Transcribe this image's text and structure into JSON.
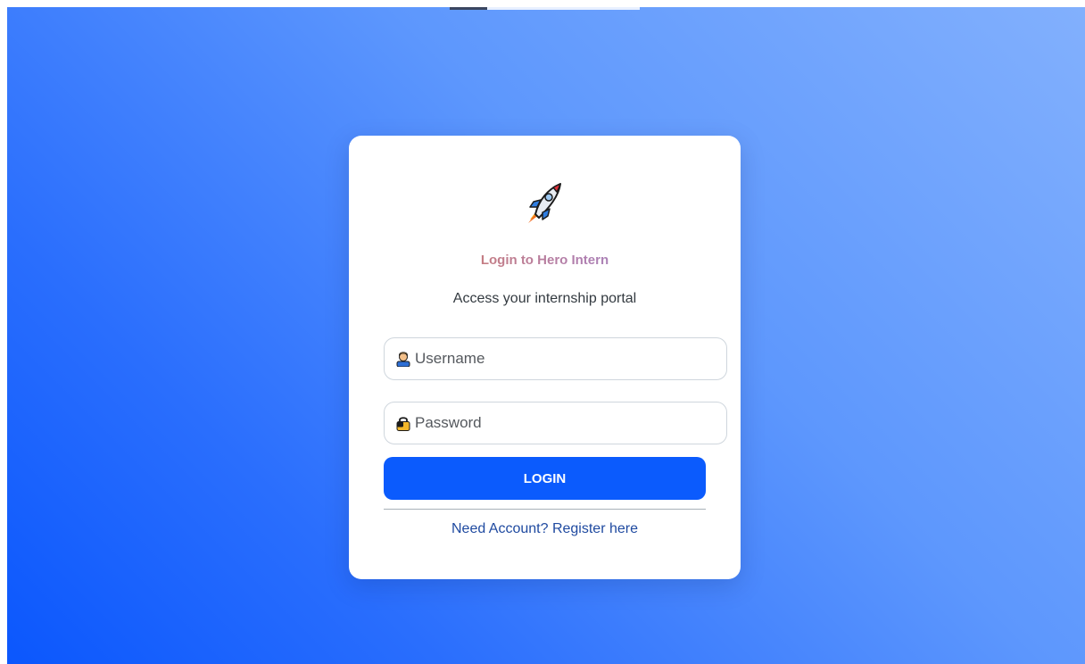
{
  "login": {
    "title": "Login to Hero Intern",
    "subtitle": "Access your internship portal",
    "username_placeholder": "Username",
    "password_placeholder": "Password",
    "username_icon": "user-icon",
    "password_icon": "lock-icon",
    "logo_icon": "rocket-icon",
    "login_label": "LOGIN",
    "register_link": "Need Account? Register here"
  },
  "colors": {
    "background_start": "#0b57fd",
    "background_end": "#82b0fd",
    "button": "#0b5bfd",
    "link": "#1f4aa0"
  }
}
